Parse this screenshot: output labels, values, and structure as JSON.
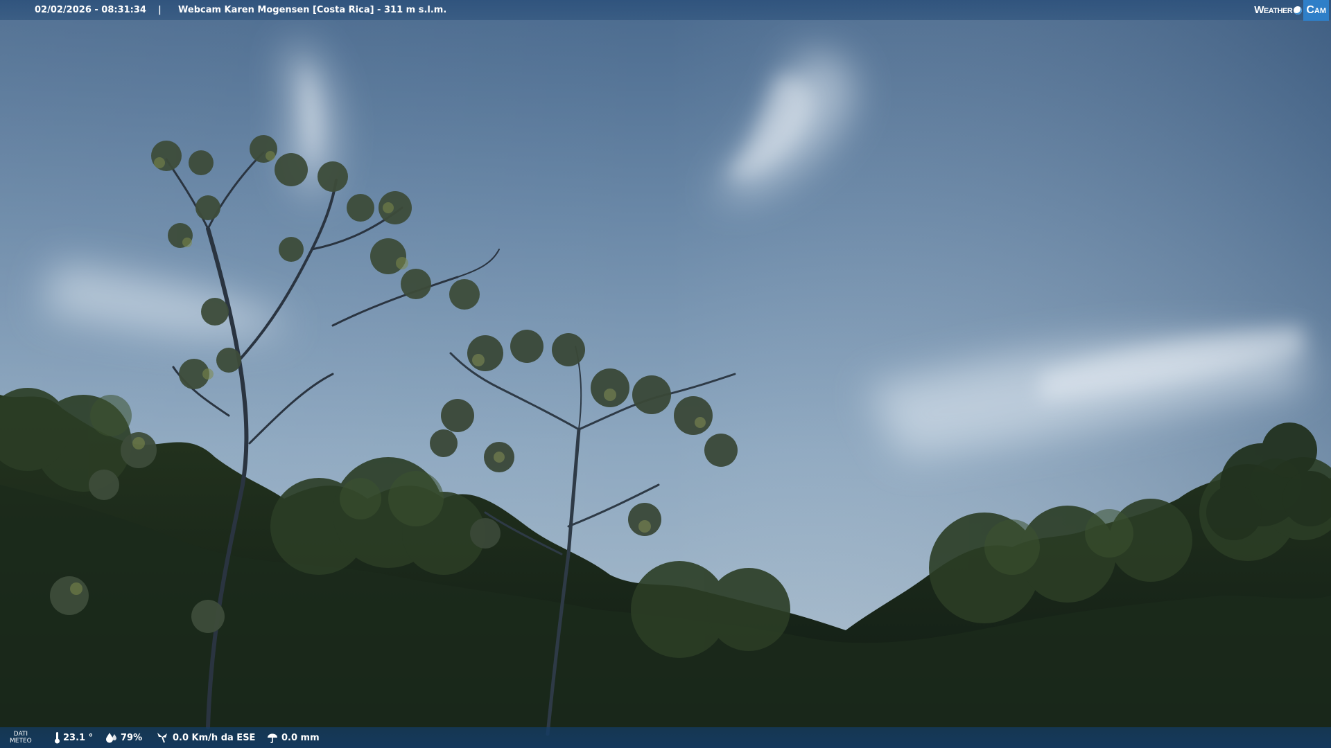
{
  "header": {
    "datetime": "02/02/2026 - 08:31:34",
    "separator": "|",
    "title": "Webcam Karen Mogensen [Costa Rica] - 311 m s.l.m."
  },
  "brand": {
    "weather": "Weather",
    "cam": "Cam",
    "accent_color": "#2f7fc8"
  },
  "weather_bar": {
    "label_line1": "DATI",
    "label_line2": "METEO",
    "temperature": "23.1 °",
    "humidity": "79%",
    "wind": "0.0 Km/h da ESE",
    "rain": "0.0 mm",
    "icons": [
      "thermometer-icon",
      "humidity-icon",
      "wind-icon",
      "rain-icon"
    ]
  }
}
